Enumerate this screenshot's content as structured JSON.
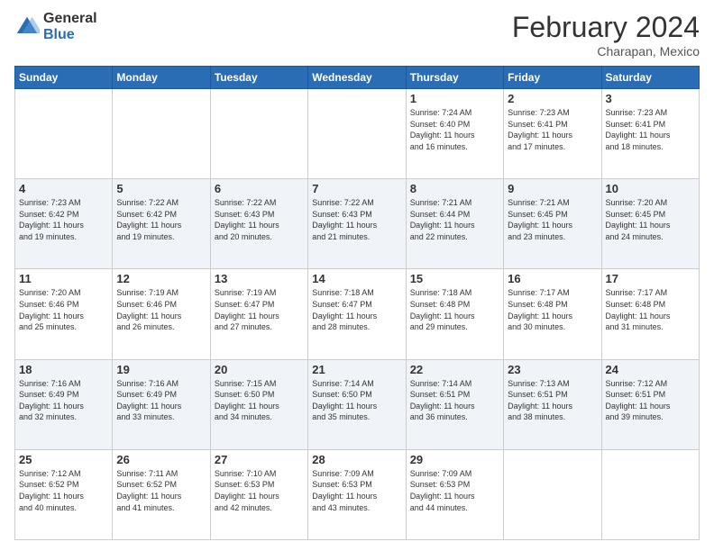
{
  "header": {
    "logo_general": "General",
    "logo_blue": "Blue",
    "month_title": "February 2024",
    "location": "Charapan, Mexico"
  },
  "columns": [
    "Sunday",
    "Monday",
    "Tuesday",
    "Wednesday",
    "Thursday",
    "Friday",
    "Saturday"
  ],
  "rows": [
    [
      {
        "day": "",
        "info": ""
      },
      {
        "day": "",
        "info": ""
      },
      {
        "day": "",
        "info": ""
      },
      {
        "day": "",
        "info": ""
      },
      {
        "day": "1",
        "info": "Sunrise: 7:24 AM\nSunset: 6:40 PM\nDaylight: 11 hours\nand 16 minutes."
      },
      {
        "day": "2",
        "info": "Sunrise: 7:23 AM\nSunset: 6:41 PM\nDaylight: 11 hours\nand 17 minutes."
      },
      {
        "day": "3",
        "info": "Sunrise: 7:23 AM\nSunset: 6:41 PM\nDaylight: 11 hours\nand 18 minutes."
      }
    ],
    [
      {
        "day": "4",
        "info": "Sunrise: 7:23 AM\nSunset: 6:42 PM\nDaylight: 11 hours\nand 19 minutes."
      },
      {
        "day": "5",
        "info": "Sunrise: 7:22 AM\nSunset: 6:42 PM\nDaylight: 11 hours\nand 19 minutes."
      },
      {
        "day": "6",
        "info": "Sunrise: 7:22 AM\nSunset: 6:43 PM\nDaylight: 11 hours\nand 20 minutes."
      },
      {
        "day": "7",
        "info": "Sunrise: 7:22 AM\nSunset: 6:43 PM\nDaylight: 11 hours\nand 21 minutes."
      },
      {
        "day": "8",
        "info": "Sunrise: 7:21 AM\nSunset: 6:44 PM\nDaylight: 11 hours\nand 22 minutes."
      },
      {
        "day": "9",
        "info": "Sunrise: 7:21 AM\nSunset: 6:45 PM\nDaylight: 11 hours\nand 23 minutes."
      },
      {
        "day": "10",
        "info": "Sunrise: 7:20 AM\nSunset: 6:45 PM\nDaylight: 11 hours\nand 24 minutes."
      }
    ],
    [
      {
        "day": "11",
        "info": "Sunrise: 7:20 AM\nSunset: 6:46 PM\nDaylight: 11 hours\nand 25 minutes."
      },
      {
        "day": "12",
        "info": "Sunrise: 7:19 AM\nSunset: 6:46 PM\nDaylight: 11 hours\nand 26 minutes."
      },
      {
        "day": "13",
        "info": "Sunrise: 7:19 AM\nSunset: 6:47 PM\nDaylight: 11 hours\nand 27 minutes."
      },
      {
        "day": "14",
        "info": "Sunrise: 7:18 AM\nSunset: 6:47 PM\nDaylight: 11 hours\nand 28 minutes."
      },
      {
        "day": "15",
        "info": "Sunrise: 7:18 AM\nSunset: 6:48 PM\nDaylight: 11 hours\nand 29 minutes."
      },
      {
        "day": "16",
        "info": "Sunrise: 7:17 AM\nSunset: 6:48 PM\nDaylight: 11 hours\nand 30 minutes."
      },
      {
        "day": "17",
        "info": "Sunrise: 7:17 AM\nSunset: 6:48 PM\nDaylight: 11 hours\nand 31 minutes."
      }
    ],
    [
      {
        "day": "18",
        "info": "Sunrise: 7:16 AM\nSunset: 6:49 PM\nDaylight: 11 hours\nand 32 minutes."
      },
      {
        "day": "19",
        "info": "Sunrise: 7:16 AM\nSunset: 6:49 PM\nDaylight: 11 hours\nand 33 minutes."
      },
      {
        "day": "20",
        "info": "Sunrise: 7:15 AM\nSunset: 6:50 PM\nDaylight: 11 hours\nand 34 minutes."
      },
      {
        "day": "21",
        "info": "Sunrise: 7:14 AM\nSunset: 6:50 PM\nDaylight: 11 hours\nand 35 minutes."
      },
      {
        "day": "22",
        "info": "Sunrise: 7:14 AM\nSunset: 6:51 PM\nDaylight: 11 hours\nand 36 minutes."
      },
      {
        "day": "23",
        "info": "Sunrise: 7:13 AM\nSunset: 6:51 PM\nDaylight: 11 hours\nand 38 minutes."
      },
      {
        "day": "24",
        "info": "Sunrise: 7:12 AM\nSunset: 6:51 PM\nDaylight: 11 hours\nand 39 minutes."
      }
    ],
    [
      {
        "day": "25",
        "info": "Sunrise: 7:12 AM\nSunset: 6:52 PM\nDaylight: 11 hours\nand 40 minutes."
      },
      {
        "day": "26",
        "info": "Sunrise: 7:11 AM\nSunset: 6:52 PM\nDaylight: 11 hours\nand 41 minutes."
      },
      {
        "day": "27",
        "info": "Sunrise: 7:10 AM\nSunset: 6:53 PM\nDaylight: 11 hours\nand 42 minutes."
      },
      {
        "day": "28",
        "info": "Sunrise: 7:09 AM\nSunset: 6:53 PM\nDaylight: 11 hours\nand 43 minutes."
      },
      {
        "day": "29",
        "info": "Sunrise: 7:09 AM\nSunset: 6:53 PM\nDaylight: 11 hours\nand 44 minutes."
      },
      {
        "day": "",
        "info": ""
      },
      {
        "day": "",
        "info": ""
      }
    ]
  ]
}
